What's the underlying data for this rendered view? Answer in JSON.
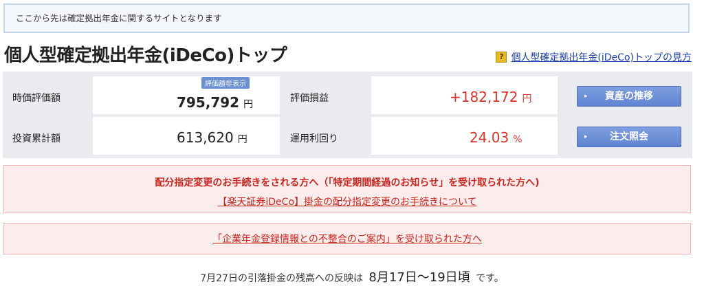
{
  "notice": "ここから先は確定拠出年金に関するサイトとなります",
  "page_title": "個人型確定拠出年金(iDeCo)トップ",
  "help": {
    "icon": "question-icon",
    "icon_glyph": "?",
    "link": "個人型確定拠出年金(iDeCo)トップの見方"
  },
  "summary": {
    "market_value_label": "時価評価額",
    "market_value": "795,792",
    "hide_badge": "評価額非表示",
    "invested_label": "投資累計額",
    "invested": "613,620",
    "gain_label": "評価損益",
    "gain": "+182,172",
    "yield_label": "運用利回り",
    "yield": "24.03",
    "currency_unit": "円",
    "percent_unit": "%"
  },
  "buttons": {
    "asset_trend": "資産の推移",
    "orders": "注文照会",
    "arrow_glyph": "▸"
  },
  "alert1": {
    "head": "配分指定変更のお手続きをされる方へ（「特定期間経過のお知らせ」を受け取られた方へ)",
    "link": "【楽天証券iDeCo】掛金の配分指定変更のお手続きについて"
  },
  "alert2": {
    "link": "「企業年金登録情報との不整合のご案内」を受け取られた方へ"
  },
  "footer": {
    "prefix": "7月27日の引落掛金の残高への反映は",
    "date_range": "8月17日〜19日頃",
    "suffix": "です。"
  },
  "colors": {
    "accent_red": "#d9342b",
    "button_blue": "#6b8fd3",
    "notice_border": "#c5d9ec"
  }
}
